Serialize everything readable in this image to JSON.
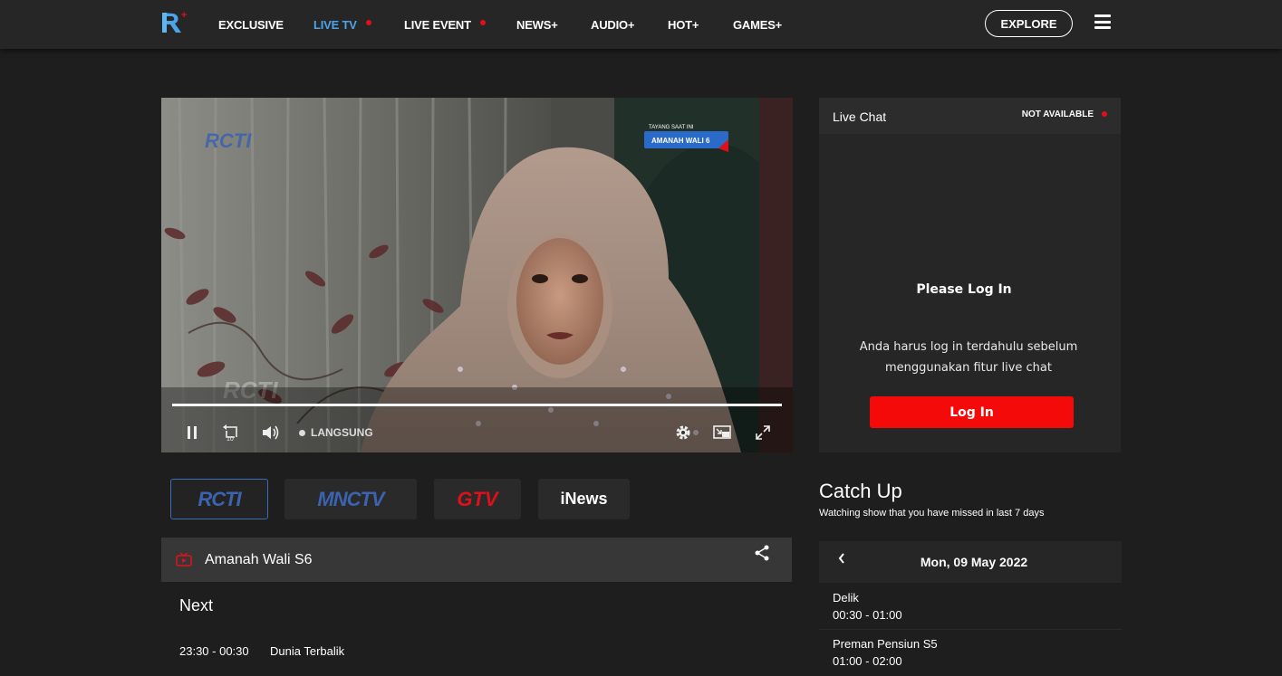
{
  "header": {
    "logo_text": "R+",
    "nav": [
      {
        "label": "EXCLUSIVE",
        "live": false
      },
      {
        "label": "LIVE TV",
        "live": true,
        "active": true
      },
      {
        "label": "LIVE EVENT",
        "live": true
      },
      {
        "label": "NEWS+",
        "live": false
      },
      {
        "label": "AUDIO+",
        "live": false
      },
      {
        "label": "HOT+",
        "live": false
      },
      {
        "label": "GAMES+",
        "live": false
      }
    ],
    "explore_label": "EXPLORE"
  },
  "player": {
    "watermark": "RCTI",
    "now_showing_label": "TAYANG SAAT INI",
    "now_showing_title": "AMANAH WALI 6",
    "live_label": "LANGSUNG",
    "rewind_seconds": "10"
  },
  "chat": {
    "title": "Live Chat",
    "status": "NOT AVAILABLE",
    "login_heading": "Please Log In",
    "login_message": "Anda harus log in terdahulu sebelum menggunakan fitur live chat",
    "login_button": "Log In"
  },
  "channels": [
    {
      "name": "RCTI",
      "active": true
    },
    {
      "name": "MNCTV",
      "active": false
    },
    {
      "name": "GTV",
      "active": false
    },
    {
      "name": "iNews",
      "active": false
    }
  ],
  "now_playing": {
    "title": "Amanah Wali S6"
  },
  "next": {
    "heading": "Next",
    "items": [
      {
        "time": "23:30 - 00:30",
        "title": "Dunia Terbalik"
      }
    ]
  },
  "catchup": {
    "title": "Catch Up",
    "subtitle": "Watching show that you have missed in last 7 days",
    "date": "Mon, 09 May 2022",
    "items": [
      {
        "title": "Delik",
        "time": "00:30 - 01:00"
      },
      {
        "title": "Preman Pensiun S5",
        "time": "01:00 - 02:00"
      }
    ]
  },
  "colors": {
    "accent_blue": "#4da3e8",
    "live_red": "#e0101b",
    "button_red": "#f50a0a"
  }
}
